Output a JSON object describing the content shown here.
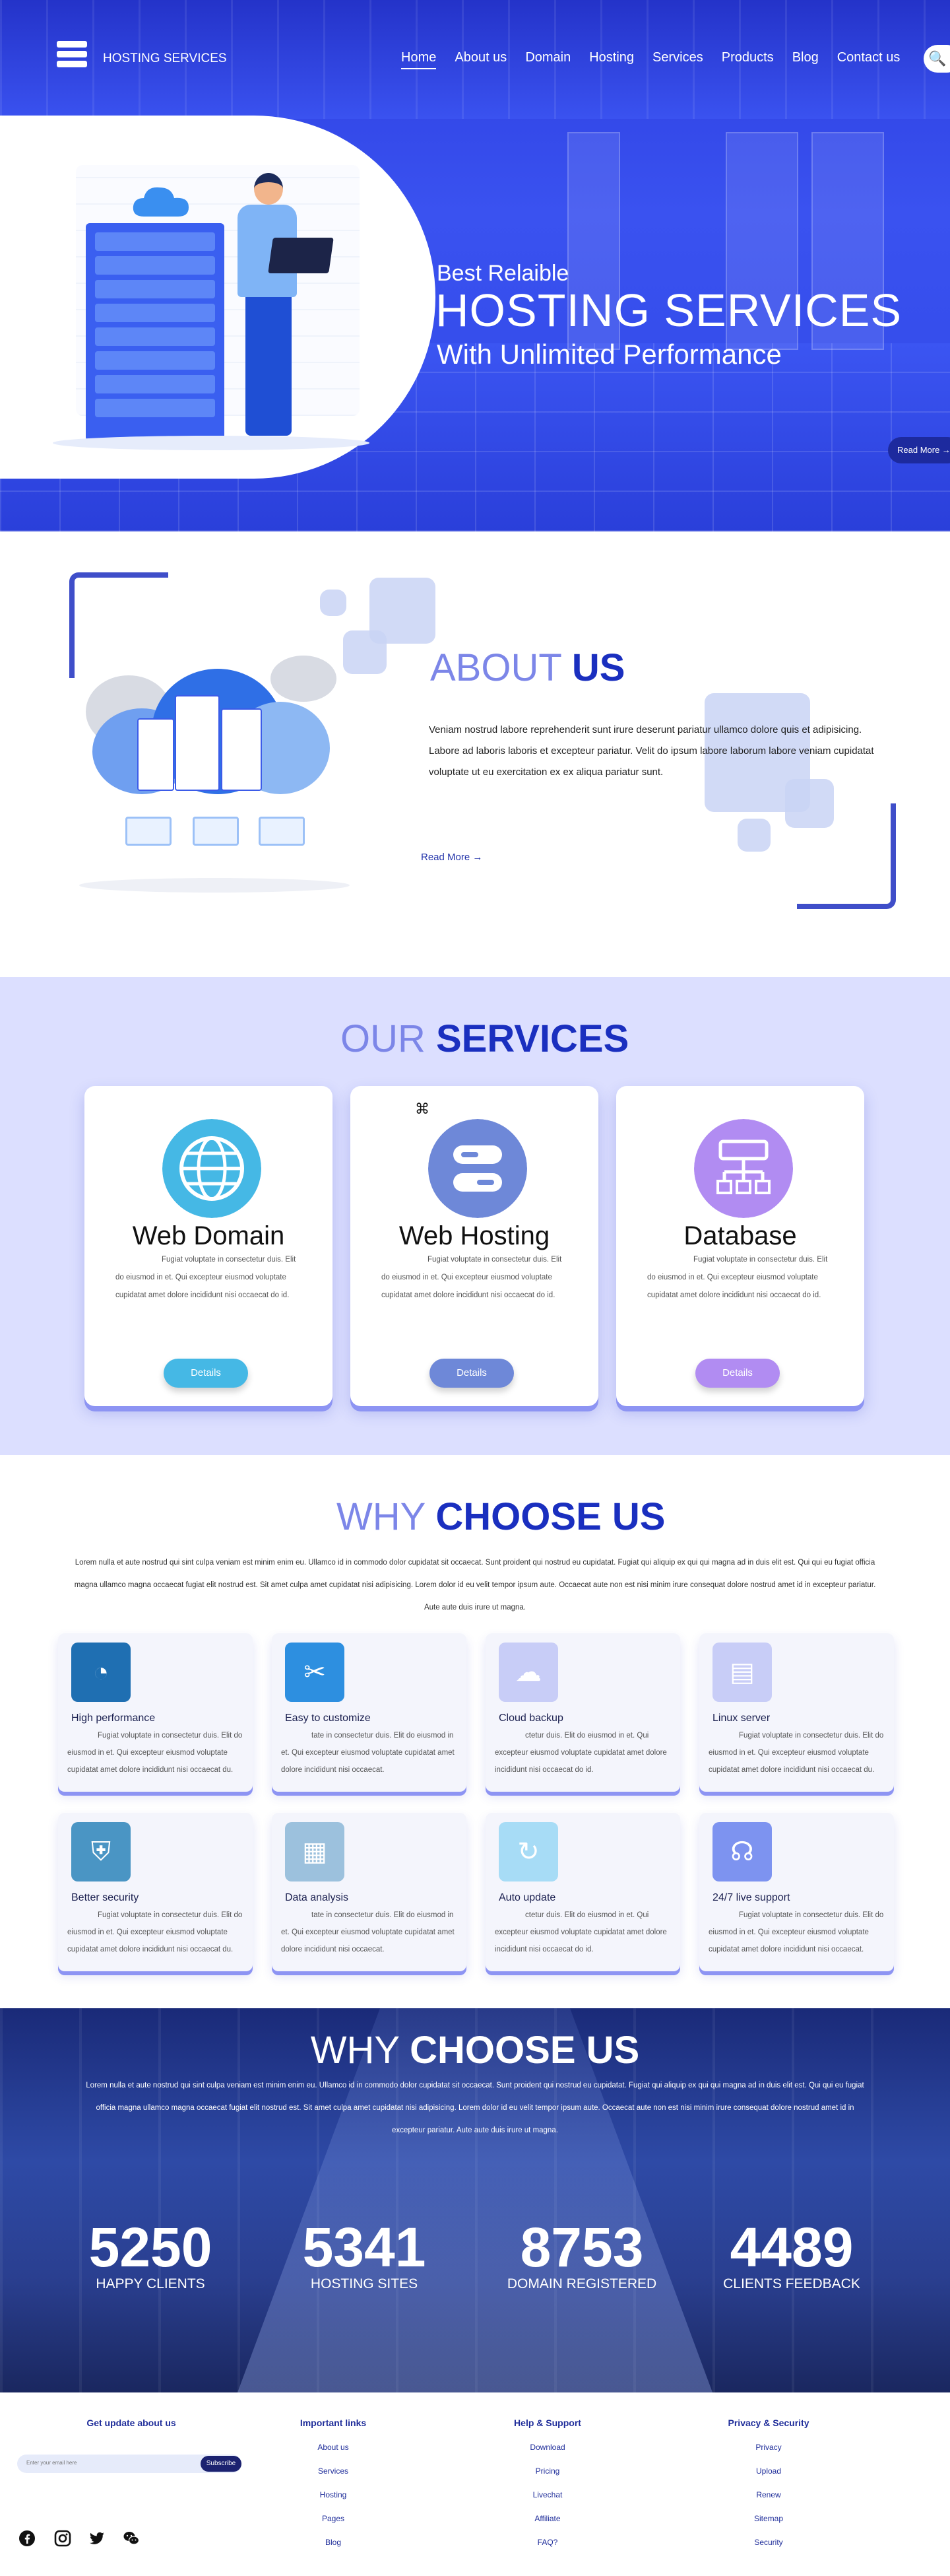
{
  "nav": {
    "brand": "HOSTING SERVICES",
    "links": [
      "Home",
      "About us",
      "Domain",
      "Hosting",
      "Services",
      "Products",
      "Blog",
      "Contact us"
    ],
    "search_icon": "🔍"
  },
  "hero": {
    "line1": "Best Relaible",
    "line2": "HOSTING SERVICES",
    "line3": "With Unlimited Performance",
    "read_more": "Read More →"
  },
  "about": {
    "title_light": "ABOUT ",
    "title_bold": "US",
    "text": "Veniam nostrud labore reprehenderit sunt irure deserunt pariatur ullamco dolore quis et adipisicing. Labore ad laboris laboris et excepteur pariatur. Velit do ipsum labore laborum labore veniam cupidatat voluptate ut eu exercitation ex ex aliqua pariatur sunt.",
    "read_more": "Read More →"
  },
  "services": {
    "title_light": "OUR ",
    "title_bold": "SERVICES",
    "cards": [
      {
        "name": "Web  Domain",
        "desc": "Fugiat voluptate in consectetur duis. Elit do eiusmod in et. Qui excepteur eiusmod voluptate cupidatat amet dolore incididunt nisi occaecat do id.",
        "button": "Details",
        "color": "#45b8e5"
      },
      {
        "name": "Web Hosting",
        "desc": "Fugiat voluptate in consectetur duis. Elit do eiusmod in et. Qui excepteur eiusmod voluptate cupidatat amet dolore incididunt nisi occaecat do id.",
        "button": "Details",
        "color": "#6e88d8"
      },
      {
        "name": "Database",
        "desc": "Fugiat voluptate in consectetur duis. Elit do eiusmod in et. Qui excepteur eiusmod voluptate cupidatat amet dolore incididunt nisi occaecat do id.",
        "button": "Details",
        "color": "#b18cf2"
      }
    ]
  },
  "why": {
    "title_light": "WHY ",
    "title_bold": "CHOOSE US",
    "desc": "Lorem nulla et aute nostrud qui sint culpa veniam est minim enim eu. Ullamco id in commodo dolor cupidatat sit occaecat. Sunt proident qui nostrud eu cupidatat. Fugiat qui aliquip ex qui qui magna ad in duis elit est. Qui qui eu fugiat officia magna ullamco magna occaecat fugiat elit nostrud est. Sit amet culpa amet cupidatat nisi adipisicing. Lorem dolor id eu velit tempor ipsum aute. Occaecat aute non est nisi minim irure consequat dolore nostrud amet id in excepteur pariatur. Aute aute duis irure ut magna.",
    "features": [
      {
        "title": "High performance",
        "icon": "speedometer-icon",
        "glyph": "◔",
        "color": "#1f6fb2",
        "desc": "Fugiat voluptate in consectetur duis. Elit do eiusmod in et. Qui excepteur eiusmod voluptate cupidatat amet dolore incididunt nisi occaecat du."
      },
      {
        "title": "Easy to customize",
        "icon": "tools-icon",
        "glyph": "✂",
        "color": "#2d8fe0",
        "desc": "tate in consectetur duis. Elit do eiusmod in et. Qui excepteur eiusmod voluptate cupidatat amet dolore incididunt nisi occaecat."
      },
      {
        "title": "Cloud backup",
        "icon": "cloud-icon",
        "glyph": "☁",
        "color": "#c8cdf7",
        "desc": "ctetur duis. Elit do eiusmod in et. Qui excepteur eiusmod voluptate cupidatat amet dolore incididunt nisi occaecat do id."
      },
      {
        "title": "Linux server",
        "icon": "server-icon",
        "glyph": "▤",
        "color": "#c8cdf7",
        "desc": "Fugiat voluptate in consectetur duis. Elit do eiusmod in et. Qui excepteur eiusmod voluptate cupidatat amet dolore incididunt nisi occaecat du."
      },
      {
        "title": "Better security",
        "icon": "shield-icon",
        "glyph": "⛨",
        "color": "#4a95c4",
        "desc": "Fugiat voluptate in consectetur duis. Elit do eiusmod in et. Qui excepteur eiusmod voluptate cupidatat amet dolore incididunt nisi occaecat du."
      },
      {
        "title": "Data analysis",
        "icon": "clipboard-icon",
        "glyph": "▦",
        "color": "#9cc1dd",
        "desc": "tate in consectetur duis. Elit do eiusmod in et. Qui excepteur eiusmod voluptate cupidatat amet dolore incididunt nisi occaecat."
      },
      {
        "title": "Auto update",
        "icon": "refresh-icon",
        "glyph": "↻",
        "color": "#a7dcf6",
        "desc": "ctetur duis. Elit do eiusmod in et. Qui excepteur eiusmod voluptate cupidatat amet dolore incididunt nisi occaecat do id."
      },
      {
        "title": "24/7 live support",
        "icon": "headset-icon",
        "glyph": "☊",
        "color": "#7d93f0",
        "desc": "Fugiat voluptate in consectetur duis. Elit do eiusmod in et. Qui excepteur eiusmod voluptate cupidatat amet dolore incididunt nisi occaecat."
      }
    ]
  },
  "stats": {
    "title_light": "WHY ",
    "title_bold": "CHOOSE US",
    "desc": "Lorem nulla et aute nostrud qui sint culpa veniam est minim enim eu. Ullamco id in commodo dolor cupidatat sit occaecat. Sunt proident qui nostrud eu cupidatat. Fugiat qui aliquip ex qui qui magna ad in duis elit est. Qui qui eu fugiat officia magna ullamco magna occaecat fugiat elit nostrud est. Sit amet culpa amet cupidatat nisi adipisicing. Lorem dolor id eu velit tempor ipsum aute. Occaecat aute non est nisi minim irure consequat dolore nostrud amet id in excepteur pariatur. Aute aute duis irure ut magna.",
    "items": [
      {
        "num": "5250",
        "label": "HAPPY CLIENTS"
      },
      {
        "num": "5341",
        "label": "HOSTING SITES"
      },
      {
        "num": "8753",
        "label": "DOMAIN REGISTERED"
      },
      {
        "num": "4489",
        "label": "CLIENTS FEEDBACK"
      }
    ]
  },
  "footer": {
    "subscribe_title": "Get update about us",
    "subscribe_placeholder": "Enter your email here",
    "subscribe_button": "Subscribe",
    "columns": [
      {
        "title": "Important links",
        "links": [
          "About us",
          "Services",
          "Hosting",
          "Pages",
          "Blog"
        ]
      },
      {
        "title": "Help & Support",
        "links": [
          "Download",
          "Pricing",
          "Livechat",
          "Affiliate",
          "FAQ?"
        ]
      },
      {
        "title": "Privacy & Security",
        "links": [
          "Privacy",
          "Upload",
          "Renew",
          "Sitemap",
          "Security"
        ]
      }
    ],
    "social": [
      "facebook-icon",
      "instagram-icon",
      "twitter-icon",
      "wechat-icon"
    ]
  }
}
